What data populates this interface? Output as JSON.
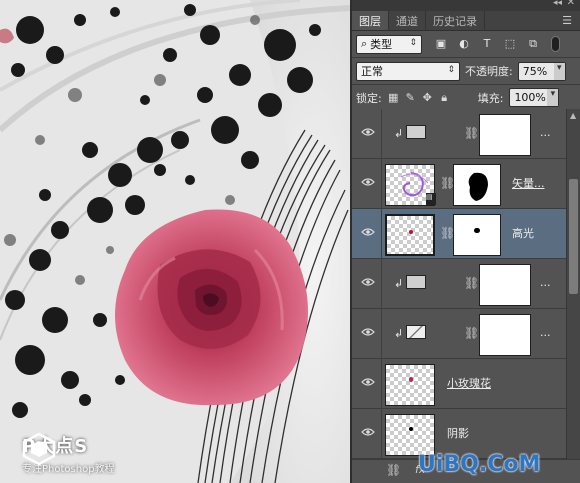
{
  "canvas": {
    "watermark_title": "P大点S",
    "watermark_sub": "专注Photoshop教程"
  },
  "panel": {
    "tabs": [
      {
        "label": "图层",
        "active": true
      },
      {
        "label": "通道",
        "active": false
      },
      {
        "label": "历史记录",
        "active": false
      }
    ],
    "filter": {
      "kind_label": "类型"
    },
    "blend_mode": "正常",
    "opacity_label": "不透明度:",
    "opacity_value": "75%",
    "lock_label": "锁定:",
    "fill_label": "填充:",
    "fill_value": "100%",
    "layers": [
      {
        "name": "...",
        "type": "adjustment",
        "clipped": true,
        "selected": false
      },
      {
        "name": "矢量...",
        "type": "smart",
        "clipped": false,
        "selected": false,
        "underline": true
      },
      {
        "name": "高光",
        "type": "pixel",
        "clipped": false,
        "selected": true
      },
      {
        "name": "...",
        "type": "adjustment",
        "clipped": true,
        "selected": false
      },
      {
        "name": "...",
        "type": "curves",
        "clipped": true,
        "selected": false
      },
      {
        "name": "小玫瑰花",
        "type": "pixel",
        "clipped": false,
        "selected": false,
        "underline": true
      },
      {
        "name": "阴影",
        "type": "pixel",
        "clipped": false,
        "selected": false
      }
    ],
    "bottom_fx": "fx"
  },
  "site_watermark": {
    "text": "UiBQ.CoM",
    "ps": "PS"
  },
  "colors": {
    "accent_selected": "#5b6d80",
    "panel_bg": "#535353",
    "rose": "#c73a5c"
  }
}
